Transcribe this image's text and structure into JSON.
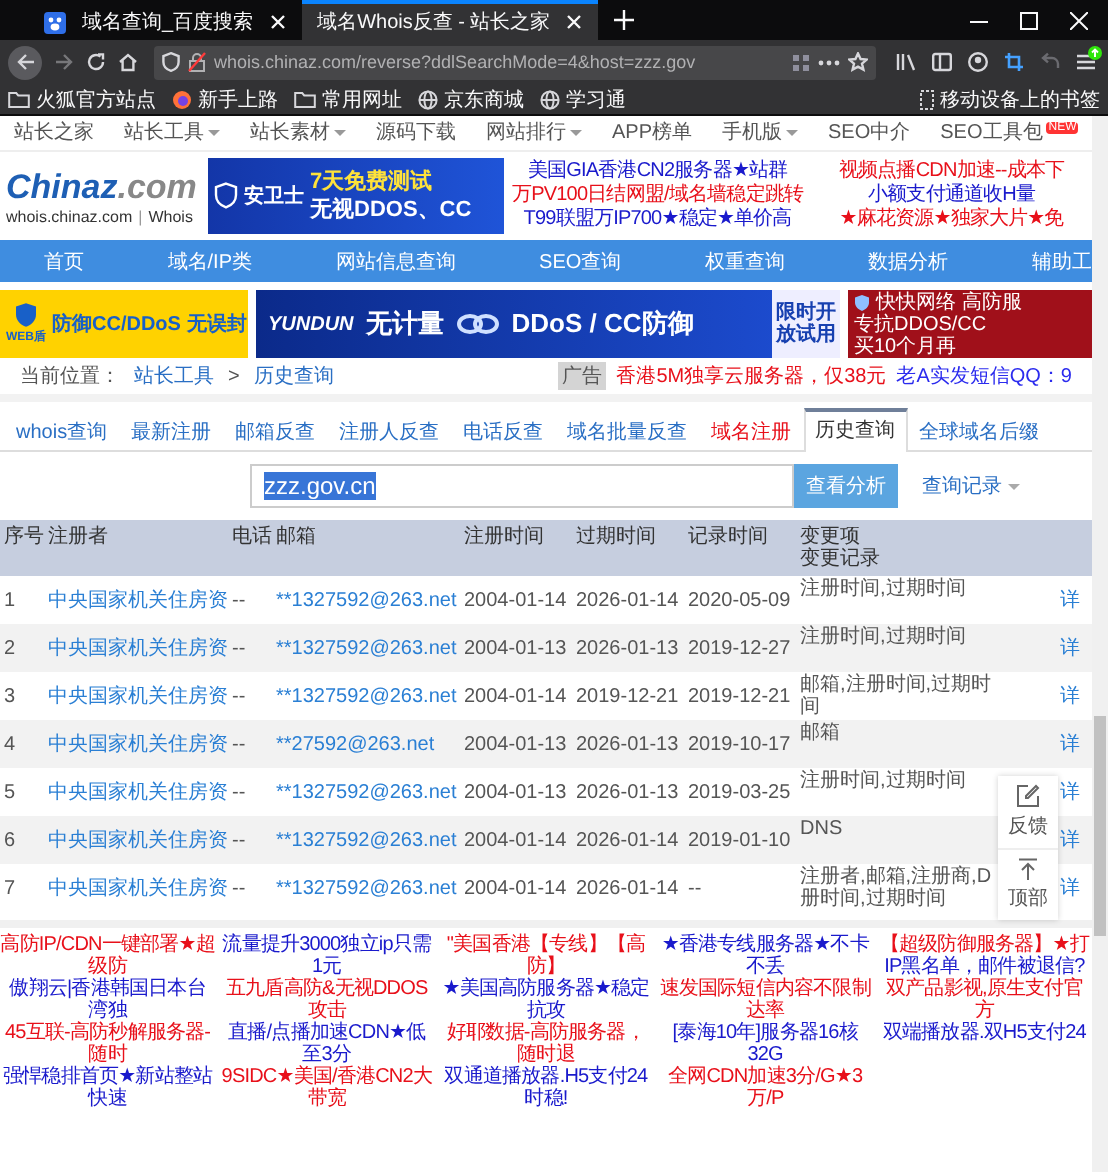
{
  "browser": {
    "tabs": [
      {
        "title": "域名查询_百度搜索",
        "favicon": true,
        "selected": false
      },
      {
        "title": "域名Whois反查 - 站长之家",
        "favicon": false,
        "selected": true
      }
    ],
    "url": "whois.chinaz.com/reverse?ddlSearchMode=4&host=zzz.gov",
    "bookmarks": [
      {
        "label": "火狐官方站点",
        "kind": "folder"
      },
      {
        "label": "新手上路",
        "kind": "browser"
      },
      {
        "label": "常用网址",
        "kind": "folder"
      },
      {
        "label": "京东商城",
        "kind": "globe"
      },
      {
        "label": "学习通",
        "kind": "globe"
      }
    ],
    "mobile_bookmarks": "移动设备上的书签"
  },
  "site_nav": [
    {
      "label": "站长之家",
      "dropdown": false
    },
    {
      "label": "站长工具",
      "dropdown": true
    },
    {
      "label": "站长素材",
      "dropdown": true
    },
    {
      "label": "源码下载",
      "dropdown": false
    },
    {
      "label": "网站排行",
      "dropdown": true
    },
    {
      "label": "APP榜单",
      "dropdown": false
    },
    {
      "label": "手机版",
      "dropdown": true
    },
    {
      "label": "SEO中介",
      "dropdown": false
    },
    {
      "label": "SEO工具包",
      "dropdown": false,
      "badge": "NEW"
    }
  ],
  "logo": {
    "brand": "Chinaz",
    "suffix": ".com",
    "site": "whois.chinaz.com",
    "divider": "|",
    "section": "Whois"
  },
  "top_banner": {
    "brand": "安卫士",
    "headline": "7天免费测试",
    "tagline": "无视DDOS、CC"
  },
  "top_ads": [
    [
      {
        "text": "美国GIA香港CN2服务器★站群",
        "color": "#1a1acc"
      },
      {
        "text": "万PV100日结网盟/域名墙稳定跳转",
        "color": "#e8101a"
      },
      {
        "text": "T99联盟万IP700★稳定★单价高",
        "color": "#1a1acc"
      }
    ],
    [
      {
        "text": "视频点播CDN加速--成本下",
        "color": "#e8101a"
      },
      {
        "text": "小额支付通道收H量",
        "color": "#1a1acc"
      },
      {
        "text": "★麻花资源★独家大片★免",
        "color": "#e8101a"
      }
    ]
  ],
  "main_nav": [
    "首页",
    "域名/IP类",
    "网站信息查询",
    "SEO查询",
    "权重查询",
    "数据分析",
    "辅助工"
  ],
  "banners": [
    {
      "kind": "shield",
      "logo": "WEB盾",
      "text": "防御CC/DDoS",
      "note": "无误封"
    },
    {
      "kind": "yundun",
      "logo": "YUNDUN",
      "text": "无计量",
      "headline": "DDoS / CC防御",
      "note": "限时开放试用"
    },
    {
      "kind": "kuaikuai",
      "logo": "快快网络",
      "text": "高防服",
      "note": "专抗DDOS/CC",
      "extra": "买10个月再"
    }
  ],
  "breadcrumb": {
    "label": "当前位置：",
    "items": [
      "站长工具",
      "历史查询"
    ],
    "separator": ">"
  },
  "notice": {
    "badge": "广告",
    "ads": [
      {
        "text": "香港5M独享云服务器，仅38元",
        "color": "#e8101a"
      },
      {
        "text": "老A实发短信QQ：9",
        "color": "#2b2bee"
      }
    ]
  },
  "tabs": [
    {
      "label": "whois查询",
      "selected": false,
      "highlighted": false
    },
    {
      "label": "最新注册",
      "selected": false,
      "highlighted": false
    },
    {
      "label": "邮箱反查",
      "selected": false,
      "highlighted": false
    },
    {
      "label": "注册人反查",
      "selected": false,
      "highlighted": false
    },
    {
      "label": "电话反查",
      "selected": false,
      "highlighted": false
    },
    {
      "label": "域名批量反查",
      "selected": false,
      "highlighted": false
    },
    {
      "label": "域名注册",
      "selected": false,
      "highlighted": true
    },
    {
      "label": "历史查询",
      "selected": true,
      "highlighted": false
    },
    {
      "label": "全球域名后缀",
      "selected": false,
      "highlighted": false
    }
  ],
  "search": {
    "value": "zzz.gov.cn",
    "text_selected": true,
    "button": "查看分析",
    "history": "查询记录"
  },
  "table": {
    "columns": [
      "序号",
      "注册者",
      "电话",
      "邮箱",
      "注册时间",
      "过期时间",
      "记录时间",
      "变更项"
    ],
    "subheading": "变更记录",
    "rows": [
      {
        "cells": [
          "1",
          "中央国家机关住房资",
          "--",
          "**1327592@263.net",
          "2004-01-14",
          "2026-01-14",
          "2020-05-09"
        ],
        "changes": [
          "注册时间,过期时间"
        ],
        "detail": "详"
      },
      {
        "cells": [
          "2",
          "中央国家机关住房资",
          "--",
          "**1327592@263.net",
          "2004-01-13",
          "2026-01-13",
          "2019-12-27"
        ],
        "changes": [
          "注册时间,过期时间"
        ],
        "detail": "详"
      },
      {
        "cells": [
          "3",
          "中央国家机关住房资",
          "--",
          "**1327592@263.net",
          "2004-01-14",
          "2019-12-21",
          "2019-12-21"
        ],
        "changes": [
          "邮箱,注册时间,过期时间"
        ],
        "detail": "详"
      },
      {
        "cells": [
          "4",
          "中央国家机关住房资",
          "--",
          "**27592@263.net",
          "2004-01-13",
          "2026-01-13",
          "2019-10-17"
        ],
        "changes": [
          "邮箱"
        ],
        "detail": "详"
      },
      {
        "cells": [
          "5",
          "中央国家机关住房资",
          "--",
          "**1327592@263.net",
          "2004-01-13",
          "2026-01-13",
          "2019-03-25"
        ],
        "changes": [
          "注册时间,过期时间"
        ],
        "detail": "详"
      },
      {
        "cells": [
          "6",
          "中央国家机关住房资",
          "--",
          "**1327592@263.net",
          "2004-01-14",
          "2026-01-14",
          "2019-01-10"
        ],
        "changes": [
          "DNS"
        ],
        "detail": "详"
      },
      {
        "cells": [
          "7",
          "中央国家机关住房资",
          "--",
          "**1327592@263.net",
          "2004-01-14",
          "2026-01-14",
          "--"
        ],
        "changes": [
          "注册者,邮箱,注册商,D",
          "册时间,过期时间"
        ],
        "detail": "详"
      }
    ]
  },
  "float_tools": [
    {
      "kind": "feedback",
      "label": "反馈"
    },
    {
      "kind": "top",
      "label": "顶部"
    }
  ],
  "bottom_ads": [
    [
      {
        "text": "高防IP/CDN一键部署★超级防",
        "color": "#e8101a"
      },
      {
        "text": "傲翔云|香港韩国日本台湾独",
        "color": "#1a1acc"
      },
      {
        "text": "45互联-高防秒解服务器-随时",
        "color": "#e8101a"
      },
      {
        "text": "强悍稳排首页★新站整站快速",
        "color": "#1a1acc"
      }
    ],
    [
      {
        "text": "流量提升3000独立ip只需1元",
        "color": "#1a1acc"
      },
      {
        "text": "五九盾高防&无视DDOS攻击",
        "color": "#e8101a"
      },
      {
        "text": "直播/点播加速CDN★低至3分",
        "color": "#1a1acc"
      },
      {
        "text": "9SIDC★美国/香港CN2大带宽",
        "color": "#e8101a"
      }
    ],
    [
      {
        "text": "\"美国香港【专线】【高防】",
        "color": "#e8101a"
      },
      {
        "text": "★美国高防服务器★稳定抗攻",
        "color": "#1a1acc"
      },
      {
        "text": "好耶数据-高防服务器，随时退",
        "color": "#e8101a"
      },
      {
        "text": "双通道播放器.H5支付24时稳!",
        "color": "#1a1acc"
      }
    ],
    [
      {
        "text": "★香港专线服务器★不卡不丢",
        "color": "#1a1acc"
      },
      {
        "text": "速发国际短信内容不限制达率",
        "color": "#e8101a"
      },
      {
        "text": "[泰海10年]服务器16核32G",
        "color": "#1a1acc"
      },
      {
        "text": "全网CDN加速3分/G★3万/P",
        "color": "#e8101a"
      }
    ],
    [
      {
        "text": "【超级防御服务器】★打",
        "color": "#e8101a"
      },
      {
        "text": "IP黑名单，邮件被退信?",
        "color": "#1a1acc"
      },
      {
        "text": "双产品影视,原生支付官方",
        "color": "#e8101a"
      },
      {
        "text": "双端播放器.双H5支付24",
        "color": "#1a1acc"
      }
    ]
  ]
}
